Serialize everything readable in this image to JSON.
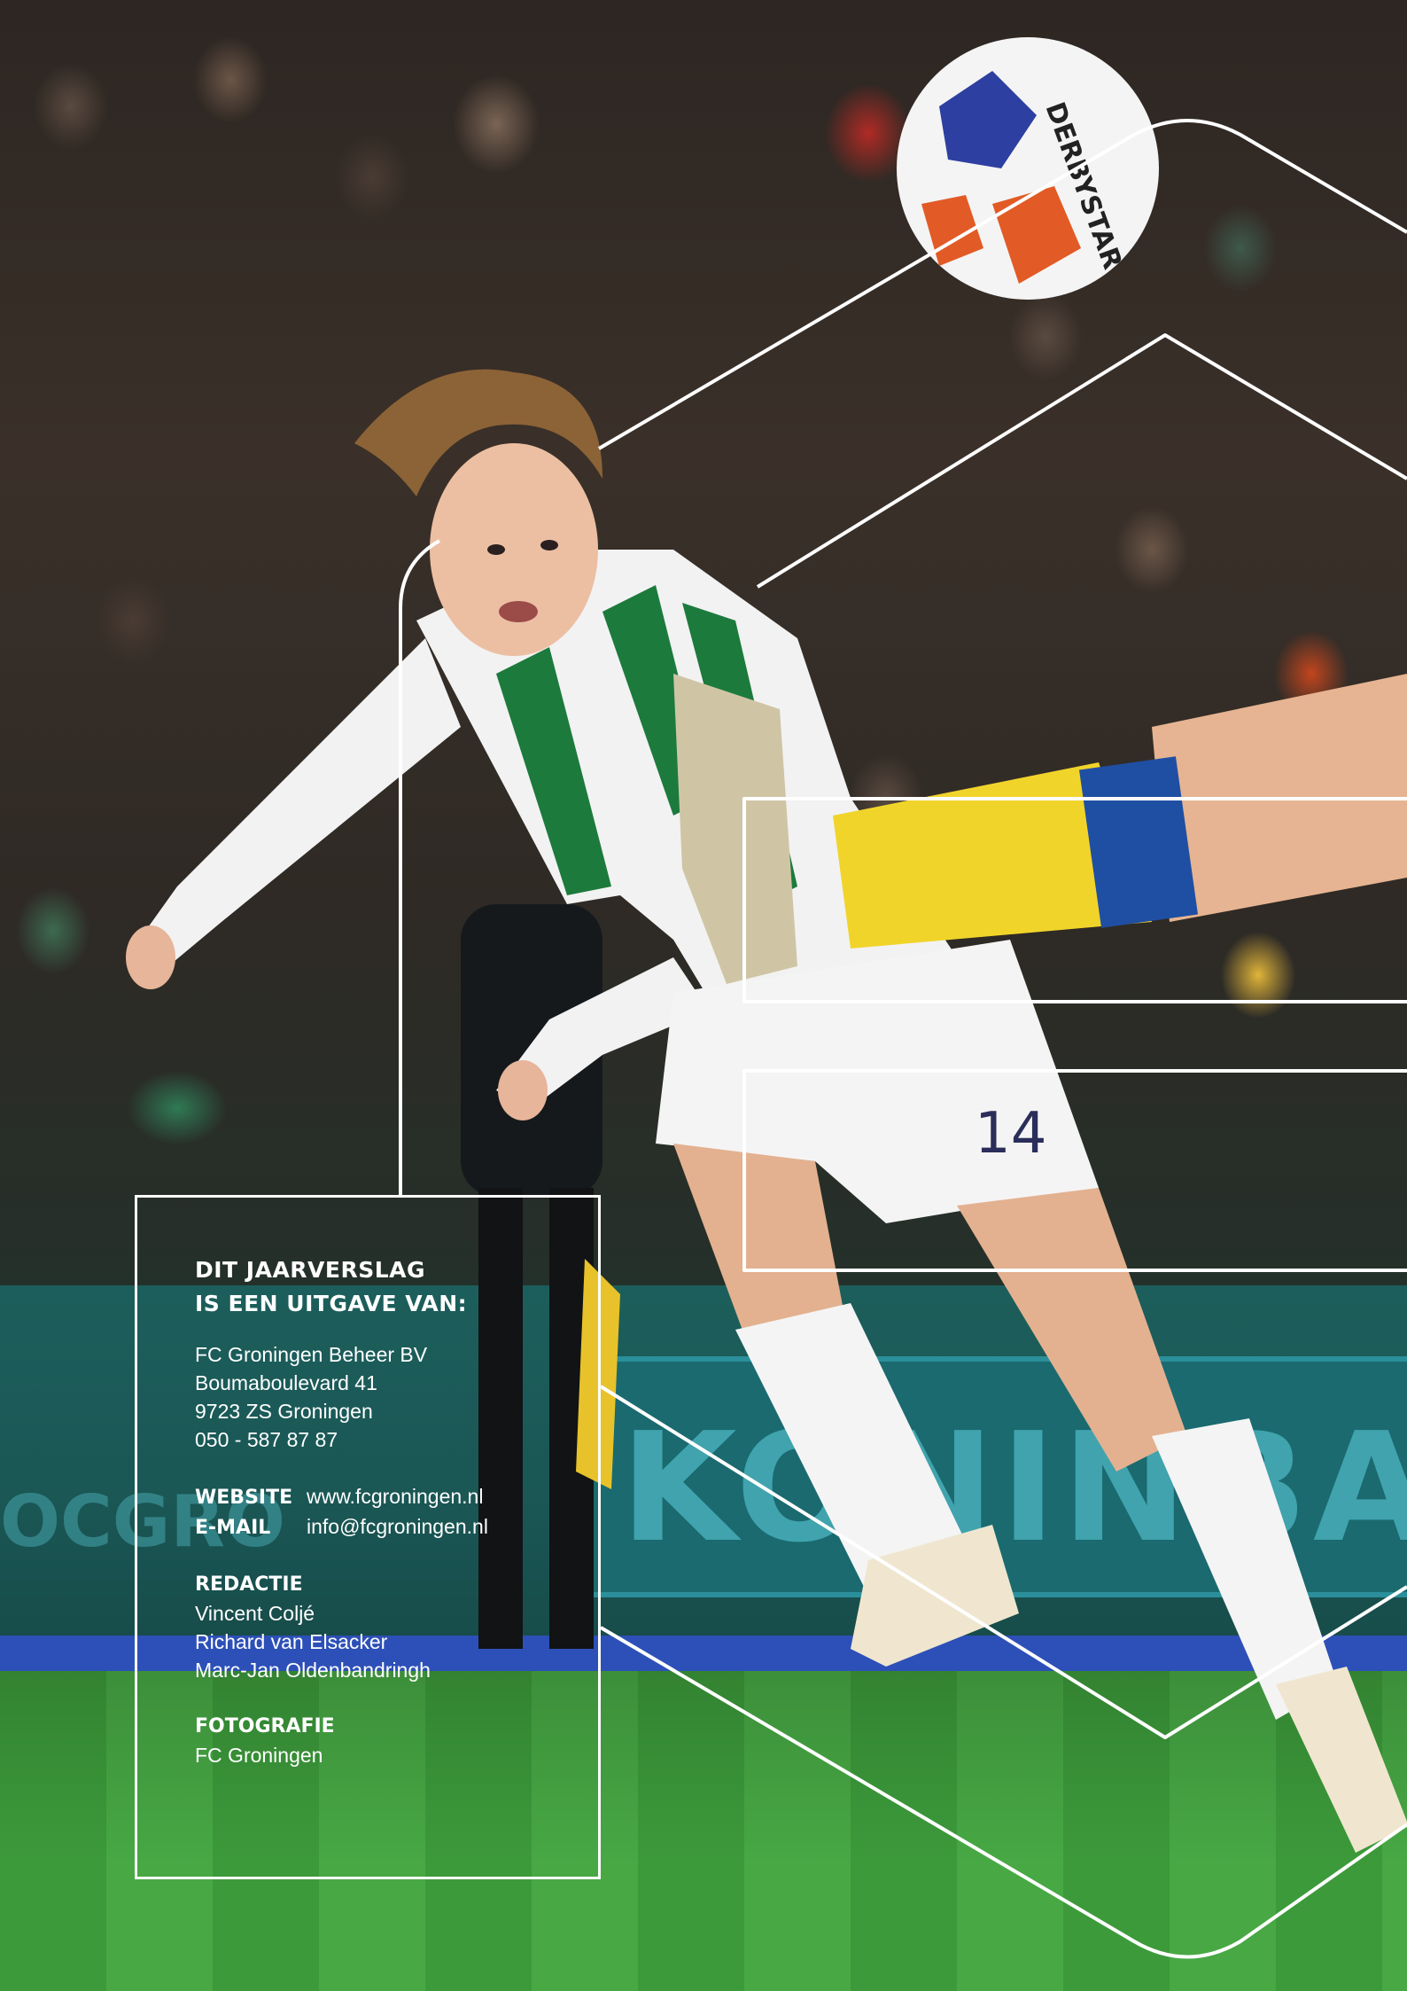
{
  "colophon": {
    "heading_line1": "DIT JAARVERSLAG",
    "heading_line2": "IS EEN UITGAVE VAN:",
    "address": [
      "FC Groningen Beheer BV",
      "Boumaboulevard 41",
      "9723 ZS Groningen",
      "050 - 587 87 87"
    ],
    "website_label": "WEBSITE",
    "website_value": "www.fcgroningen.nl",
    "email_label": "E-MAIL",
    "email_value": "info@fcgroningen.nl",
    "redactie_title": "REDACTIE",
    "redactie": [
      "Vincent Coljé",
      "Richard van Elsacker",
      "Marc-Jan Oldenbandringh"
    ],
    "fotografie_title": "FOTOGRAFIE",
    "fotografie": [
      "FC Groningen"
    ]
  },
  "photo": {
    "ball_brand": "DERBYSTAR",
    "shirt_number": "14",
    "board_text": "KONINBACH",
    "board_text_left": "OCGRO"
  }
}
